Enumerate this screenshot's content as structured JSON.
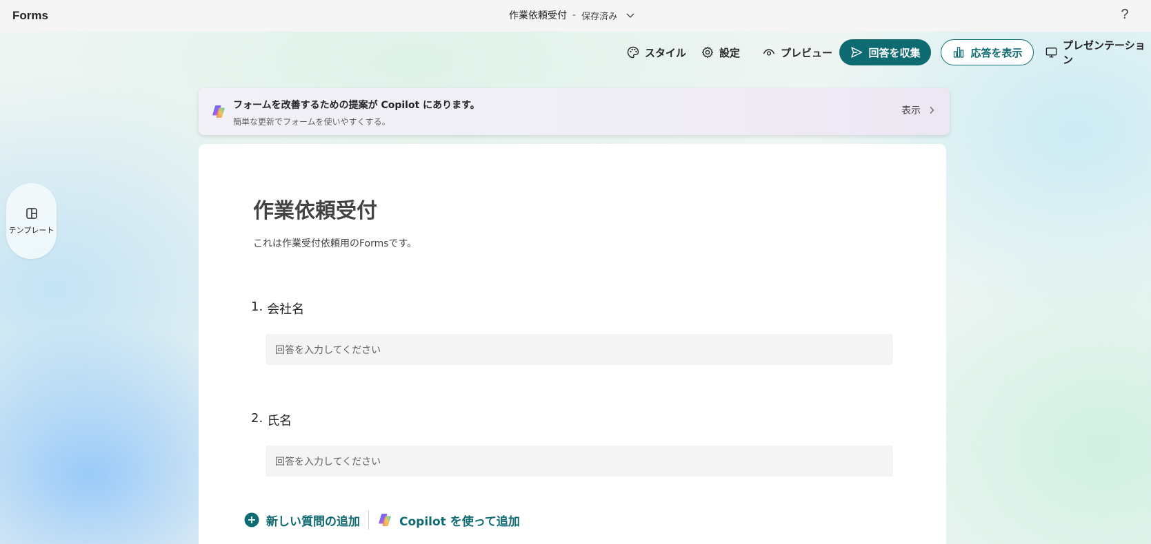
{
  "header": {
    "app_name": "Forms",
    "doc_title": "作業依頼受付",
    "separator": "-",
    "save_status": "保存済み",
    "help_glyph": "?"
  },
  "toolbar": {
    "style_label": "スタイル",
    "settings_label": "設定",
    "preview_label": "プレビュー",
    "collect_label": "回答を収集",
    "responses_label": "応答を表示",
    "present_label": "プレゼンテーション"
  },
  "sidebar": {
    "template_label": "テンプレート"
  },
  "copilot_banner": {
    "title": "フォームを改善するための提案が Copilot にあります。",
    "subtitle": "簡単な更新でフォームを使いやすくする。",
    "show_label": "表示"
  },
  "form": {
    "title": "作業依頼受付",
    "description": "これは作業受付依頼用のFormsです。",
    "questions": [
      {
        "number": "1.",
        "label": "会社名",
        "placeholder": "回答を入力してください"
      },
      {
        "number": "2.",
        "label": "氏名",
        "placeholder": "回答を入力してください"
      }
    ],
    "add_question_label": "新しい質問の追加",
    "add_with_copilot_label": "Copilot を使って追加"
  },
  "colors": {
    "accent": "#0f6b72",
    "header_bg": "#f5f5f5",
    "input_bg": "#f4f4f4"
  },
  "icons": {
    "style": "palette-icon",
    "settings": "gear-icon",
    "preview": "eye-icon",
    "collect": "send-icon",
    "responses": "bar-chart-icon",
    "present": "monitor-icon",
    "template": "layout-grid-icon",
    "copilot": "copilot-icon",
    "add": "plus-circle-icon"
  }
}
